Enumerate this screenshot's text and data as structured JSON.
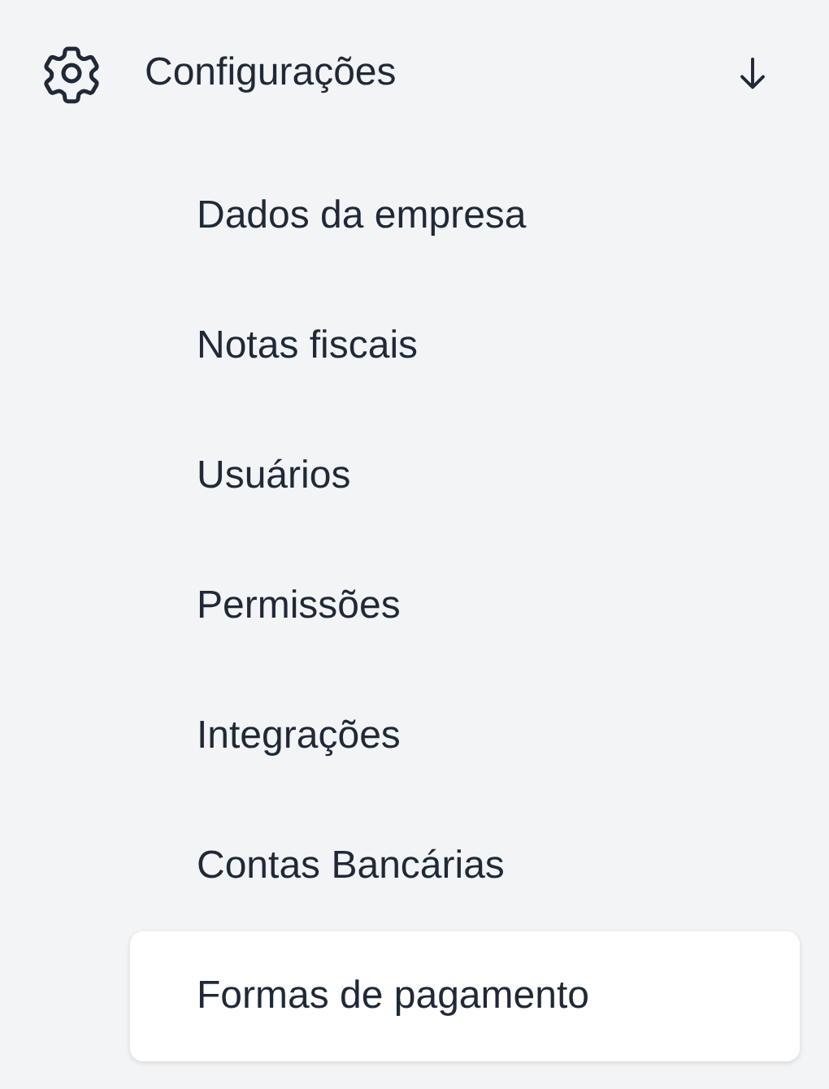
{
  "section": {
    "title": "Configurações",
    "expanded": true,
    "items": [
      {
        "label": "Dados da empresa",
        "selected": false
      },
      {
        "label": "Notas fiscais",
        "selected": false
      },
      {
        "label": "Usuários",
        "selected": false
      },
      {
        "label": "Permissões",
        "selected": false
      },
      {
        "label": "Integrações",
        "selected": false
      },
      {
        "label": "Contas Bancárias",
        "selected": false
      },
      {
        "label": "Formas de pagamento",
        "selected": true
      }
    ]
  }
}
